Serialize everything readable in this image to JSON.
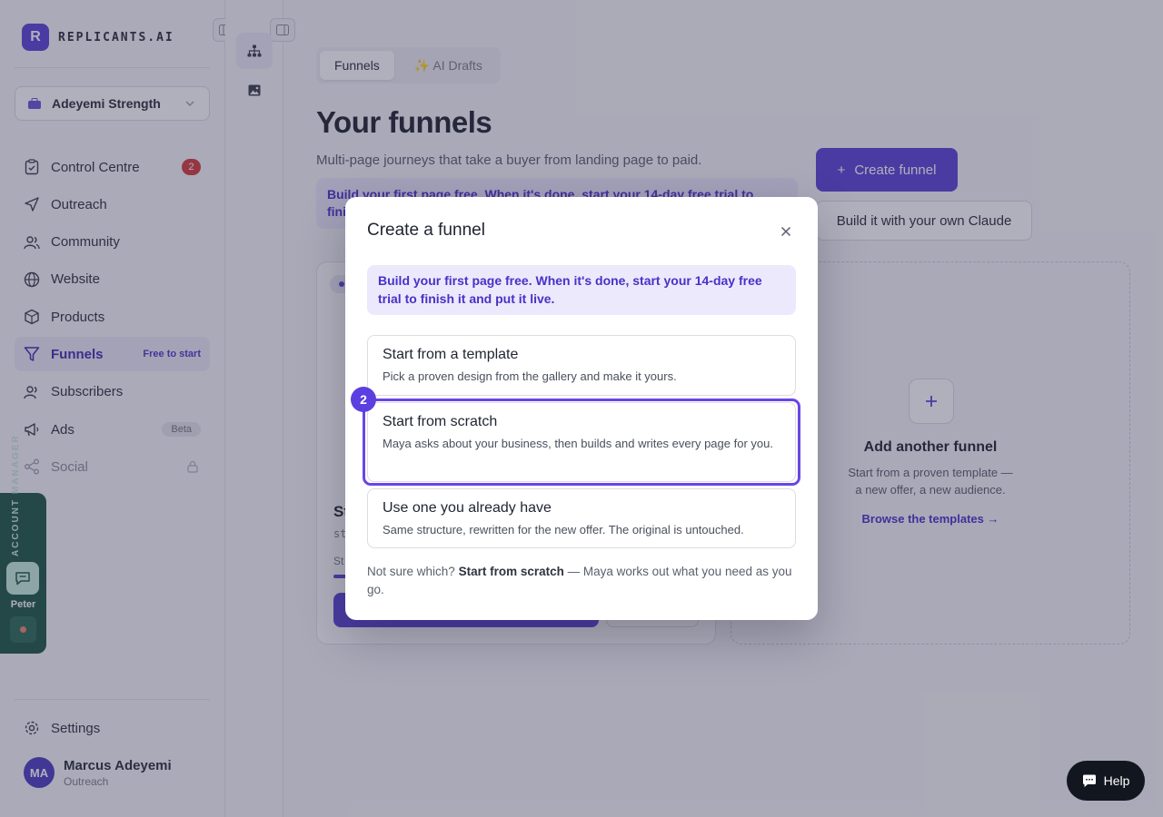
{
  "brand": {
    "logo_letter": "R",
    "name": "REPLICANTS.AI"
  },
  "workspace": {
    "name": "Adeyemi Strength"
  },
  "nav": [
    {
      "label": "Control Centre",
      "icon": "clipboard-icon",
      "badge": "2"
    },
    {
      "label": "Outreach",
      "icon": "send-icon"
    },
    {
      "label": "Community",
      "icon": "users-icon"
    },
    {
      "label": "Website",
      "icon": "globe-icon"
    },
    {
      "label": "Products",
      "icon": "box-icon"
    },
    {
      "label": "Funnels",
      "icon": "funnel-icon",
      "tag": "Free to start",
      "active": true
    },
    {
      "label": "Subscribers",
      "icon": "subscribers-icon"
    },
    {
      "label": "Ads",
      "icon": "megaphone-icon",
      "tag": "Beta"
    },
    {
      "label": "Social",
      "icon": "share-icon",
      "locked": true
    }
  ],
  "settings_label": "Settings",
  "user": {
    "initials": "MA",
    "name": "Marcus Adeyemi",
    "role": "Outreach"
  },
  "account_manager": {
    "label_1": "ACCOUNT",
    "label_2": "MANAGER",
    "name": "Peter"
  },
  "main": {
    "tabs": [
      {
        "label": "Funnels",
        "active": true
      },
      {
        "label": "✨ AI Drafts",
        "active": false
      }
    ],
    "title": "Your funnels",
    "subtitle": "Multi-page journeys that take a buyer from landing page to paid.",
    "promo": "Build your first page free. When it's done, start your 14-day free trial to finish it and put it live.",
    "create_button": "Create funnel",
    "claude_button": "Build it with your own Claude",
    "add_card": {
      "title": "Add another funnel",
      "desc_line1": "Start from a proven template —",
      "desc_line2": "a new offer, a new audience.",
      "link": "Browse the templates"
    },
    "stub_card": {
      "title_fragment": "St",
      "small_fragment": "st",
      "small2_fragment": "St"
    }
  },
  "modal": {
    "title": "Create a funnel",
    "promo": "Build your first page free. When it's done, start your 14-day free trial to finish it and put it live.",
    "step_badge": "2",
    "options": [
      {
        "title": "Start from a template",
        "desc": "Pick a proven design from the gallery and make it yours."
      },
      {
        "title": "Start from scratch",
        "desc": "Maya asks about your business, then builds and writes every page for you."
      },
      {
        "title": "Use one you already have",
        "desc": "Same structure, rewritten for the new offer. The original is untouched."
      }
    ],
    "footer_prefix": "Not sure which?",
    "footer_bold": "Start from scratch",
    "footer_suffix": "— Maya works out what you need as you go."
  },
  "help_label": "Help",
  "colors": {
    "accent": "#5b45d6",
    "badge_red": "#d63c3c",
    "account_green": "#1e5a44"
  }
}
